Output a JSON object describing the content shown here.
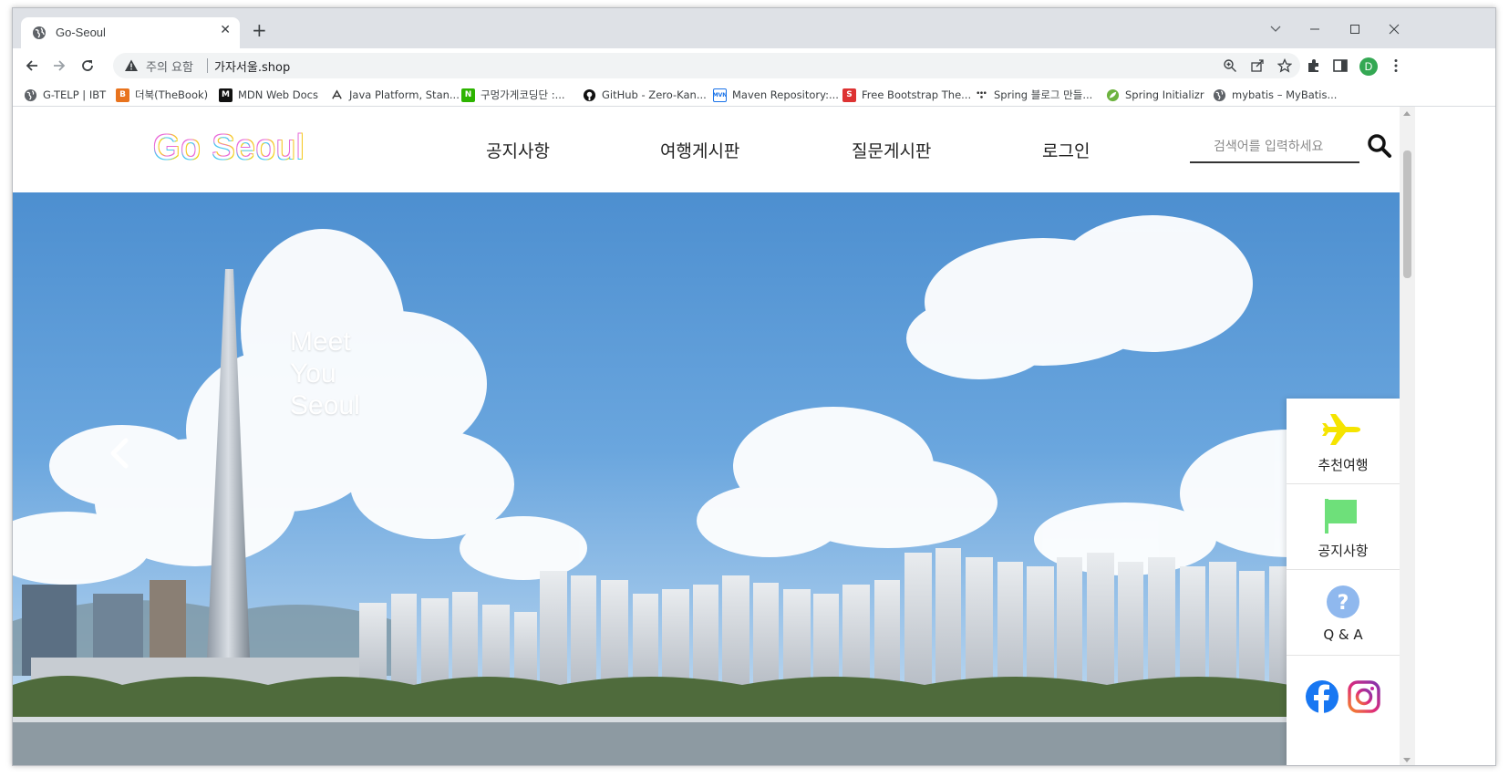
{
  "browser": {
    "tab_title": "Go-Seoul",
    "new_tab_label": "+",
    "close_tab_label": "✕",
    "security_warning": "주의 요함",
    "url": "가자서울.shop",
    "profile_initial": "D"
  },
  "bookmarks": [
    {
      "label": "G-TELP | IBT",
      "icon": "globe-icon",
      "color": "#5f6368"
    },
    {
      "label": "더북(TheBook)",
      "icon": "thebook-icon",
      "color": "#e8731d"
    },
    {
      "label": "MDN Web Docs",
      "icon": "mdn-icon",
      "color": "#111111"
    },
    {
      "label": "Java Platform, Stan...",
      "icon": "java-icon",
      "color": "#333333"
    },
    {
      "label": "구멍가게코딩단 :...",
      "icon": "naver-cafe-icon",
      "color": "#2db400"
    },
    {
      "label": "GitHub - Zero-Kan...",
      "icon": "github-icon",
      "color": "#111111"
    },
    {
      "label": "Maven Repository:...",
      "icon": "maven-icon",
      "color": "#1a73e8"
    },
    {
      "label": "Free Bootstrap The...",
      "icon": "startbootstrap-icon",
      "color": "#dd3333"
    },
    {
      "label": "Spring 블로그 만들...",
      "icon": "dots-icon",
      "color": "#333333"
    },
    {
      "label": "Spring Initializr",
      "icon": "spring-icon",
      "color": "#6db33f"
    },
    {
      "label": "mybatis – MyBatis...",
      "icon": "globe-icon",
      "color": "#5f6368"
    }
  ],
  "site": {
    "logo": "Go Seoul",
    "nav": [
      "공지사항",
      "여행게시판",
      "질문게시판",
      "로그인"
    ],
    "search_placeholder": "검색어를 입력하세요"
  },
  "hero": {
    "lines": [
      "Meet",
      "You",
      "Seoul"
    ]
  },
  "side_menu": [
    {
      "label": "추천여행",
      "icon": "airplane-icon",
      "color": "#f5e400"
    },
    {
      "label": "공지사항",
      "icon": "flag-icon",
      "color": "#6ee07a"
    },
    {
      "label": "Q & A",
      "icon": "question-icon",
      "color": "#8fb8ee"
    }
  ],
  "social": [
    {
      "icon": "facebook-icon",
      "color": "#1877f2"
    },
    {
      "icon": "instagram-icon",
      "color": "#c32aa3"
    }
  ]
}
